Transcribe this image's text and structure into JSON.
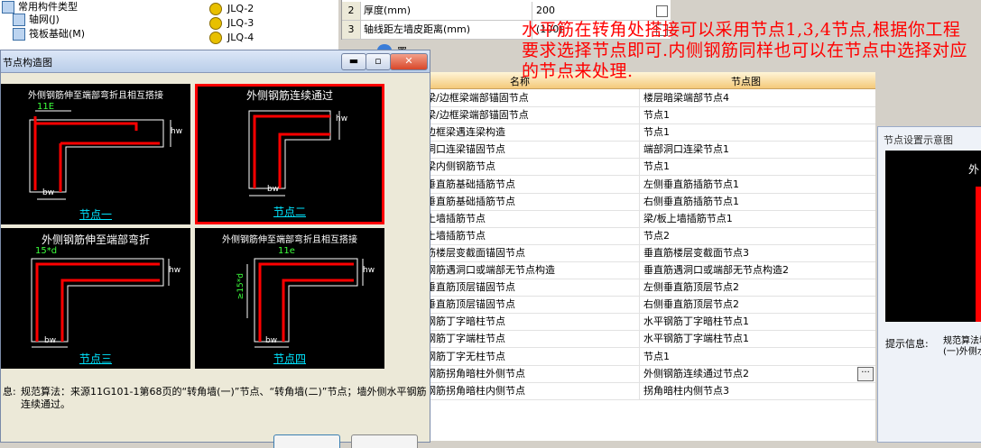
{
  "tree": {
    "items": [
      "常用构件类型",
      "轴网(J)",
      "筏板基础(M)",
      "JLQ-2",
      "JLQ-3",
      "JLQ-4"
    ]
  },
  "props": {
    "rows": [
      {
        "num": "2",
        "name": "厚度(mm)",
        "value": "200"
      },
      {
        "num": "3",
        "name": "轴线距左墙皮距离(mm)",
        "value": "(100)"
      }
    ]
  },
  "tab_tail_label": "置",
  "annotation": "水平筋在转角处搭接可以采用节点1,3,4节点,根据你工程要求选择节点即可.内侧钢筋同样也可以在节点中选择对应的节点来处理.",
  "grid": {
    "header_name": "名称",
    "header_value": "节点图",
    "rows": [
      {
        "name": "梁/边框梁端部锚固节点",
        "value": "楼层暗梁端部节点4"
      },
      {
        "name": "梁/边框梁端部锚固节点",
        "value": "节点1"
      },
      {
        "name": "边框梁遇连梁构造",
        "value": "节点1"
      },
      {
        "name": "洞口连梁锚固节点",
        "value": "端部洞口连梁节点1"
      },
      {
        "name": "梁内侧钢筋节点",
        "value": "节点1"
      },
      {
        "name": "垂直筋基础插筋节点",
        "value": "左侧垂直筋插筋节点1"
      },
      {
        "name": "垂直筋基础插筋节点",
        "value": "右侧垂直筋插筋节点1"
      },
      {
        "name": "上墙插筋节点",
        "value": "梁/板上墙插筋节点1"
      },
      {
        "name": "上墙插筋节点",
        "value": "节点2"
      },
      {
        "name": "筋楼层变截面锚固节点",
        "value": "垂直筋楼层变截面节点3"
      },
      {
        "name": "钢筋遇洞口或端部无节点构造",
        "value": "垂直筋遇洞口或端部无节点构造2"
      },
      {
        "name": "垂直筋顶层锚固节点",
        "value": "左侧垂直筋顶层节点2"
      },
      {
        "name": "垂直筋顶层锚固节点",
        "value": "右侧垂直筋顶层节点2"
      },
      {
        "name": "钢筋丁字暗柱节点",
        "value": "水平钢筋丁字暗柱节点1"
      },
      {
        "name": "钢筋丁字端柱节点",
        "value": "水平钢筋丁字端柱节点1"
      },
      {
        "name": "钢筋丁字无柱节点",
        "value": "节点1"
      },
      {
        "name": "钢筋拐角暗柱外侧节点",
        "value": "外侧钢筋连续通过节点2"
      },
      {
        "name": "钢筋拐角暗柱内侧节点",
        "value": "拐角暗柱内侧节点3"
      }
    ],
    "more_button": "···"
  },
  "preview_panel": {
    "title": "节点设置示意图",
    "image_text": "外",
    "info_label": "提示信息:",
    "info_text": "规范算法墙(一)外侧水平"
  },
  "dialog": {
    "title": "节点构造图",
    "btn_min": "▬",
    "btn_max": "▫",
    "btn_close": "✕",
    "nodes": [
      {
        "title": "外侧钢筋伸至端部弯折且相互搭接",
        "dim": "11E",
        "caption": "节点一",
        "bw": "bw",
        "hw": "hw",
        "selected": false
      },
      {
        "title": "外侧钢筋连续通过",
        "dim": "",
        "caption": "节点二",
        "bw": "bw",
        "hw": "hw",
        "selected": true
      },
      {
        "title": "外侧钢筋伸至端部弯折",
        "dim": "15*d",
        "caption": "节点三",
        "bw": "bw",
        "hw": "hw",
        "selected": false
      },
      {
        "title": "外侧钢筋伸至端部弯折且相互搭接",
        "dim": "11e",
        "caption": "节点四",
        "bw": "bw",
        "hw": "hw",
        "side_dim": "≥15*d",
        "selected": false
      }
    ],
    "hint_label": "息:",
    "hint_text": "规范算法：来源11G101-1第68页的“转角墙(一)”节点、“转角墙(二)”节点；墙外侧水平钢筋连续通过。"
  },
  "colors": {
    "rebar": "#ff0000",
    "caption": "#00e5ff",
    "annotation": "#ff0000",
    "grid_header": "#f4c97a"
  }
}
